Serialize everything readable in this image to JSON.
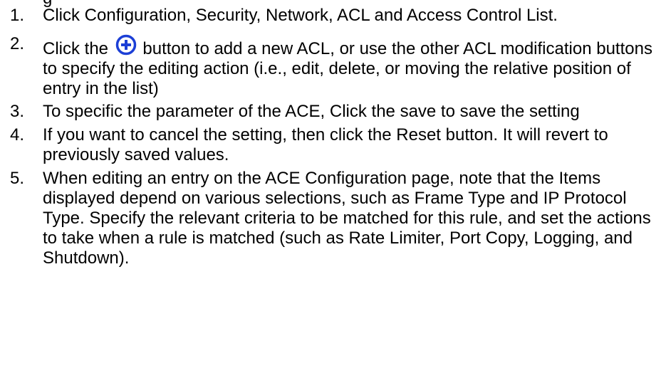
{
  "header_fragment": "g",
  "steps": [
    {
      "number": "1.",
      "text": "Click Configuration, Security, Network, ACL and Access Control List."
    },
    {
      "number": "2.",
      "text_before": "Click the",
      "icon": "add-circle-icon",
      "text_after": "button to add a new ACL, or use the other ACL modification buttons to specify the editing action (i.e., edit, delete, or moving the relative position of entry in the list)"
    },
    {
      "number": "3.",
      "text": "To specific the parameter of the ACE, Click the save to save the setting"
    },
    {
      "number": "4.",
      "text": "If you want to cancel the setting, then click the Reset button.  It will revert to previously saved values."
    },
    {
      "number": "5.",
      "text": "When editing an entry on the ACE Configuration page, note that the Items displayed depend on various selections, such as Frame Type and IP Protocol Type. Specify the relevant criteria to be matched for this rule, and set the actions to take when a rule is matched (such as Rate Limiter, Port Copy, Logging, and Shutdown)."
    }
  ],
  "colors": {
    "icon_blue": "#1c3fd6",
    "text": "#000000",
    "background": "#ffffff"
  }
}
